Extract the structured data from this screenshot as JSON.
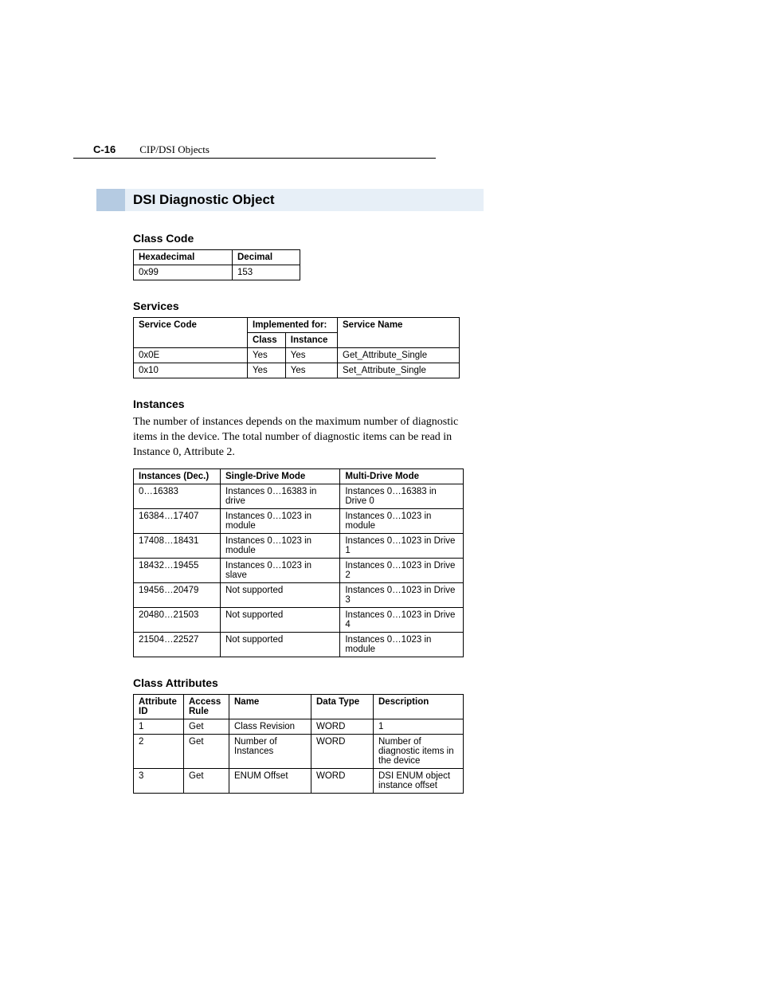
{
  "header": {
    "page_number": "C-16",
    "chapter": "CIP/DSI Objects"
  },
  "title": "DSI Diagnostic Object",
  "class_code": {
    "heading": "Class Code",
    "cols": {
      "hex": "Hexadecimal",
      "dec": "Decimal"
    },
    "row": {
      "hex": "0x99",
      "dec": "153"
    }
  },
  "services": {
    "heading": "Services",
    "cols": {
      "code": "Service Code",
      "impl": "Implemented for:",
      "class": "Class",
      "instance": "Instance",
      "name": "Service Name"
    },
    "rows": [
      {
        "code": "0x0E",
        "class": "Yes",
        "instance": "Yes",
        "name": "Get_Attribute_Single"
      },
      {
        "code": "0x10",
        "class": "Yes",
        "instance": "Yes",
        "name": "Set_Attribute_Single"
      }
    ]
  },
  "instances": {
    "heading": "Instances",
    "body": "The number of instances depends on the maximum number of diagnostic items in the device. The total number of diagnostic items can be read in Instance 0, Attribute 2.",
    "cols": {
      "dec": "Instances (Dec.)",
      "single": "Single-Drive Mode",
      "multi": "Multi-Drive Mode"
    },
    "rows": [
      {
        "dec": "0…16383",
        "single": "Instances 0…16383 in drive",
        "multi": "Instances 0…16383 in Drive 0"
      },
      {
        "dec": "16384…17407",
        "single": "Instances 0…1023 in module",
        "multi": "Instances 0…1023 in module"
      },
      {
        "dec": "17408…18431",
        "single": "Instances 0…1023 in module",
        "multi": "Instances 0…1023 in Drive 1"
      },
      {
        "dec": "18432…19455",
        "single": "Instances 0…1023 in slave",
        "multi": "Instances 0…1023 in Drive 2"
      },
      {
        "dec": "19456…20479",
        "single": "Not supported",
        "multi": "Instances 0…1023 in Drive 3"
      },
      {
        "dec": "20480…21503",
        "single": "Not supported",
        "multi": "Instances 0…1023 in Drive 4"
      },
      {
        "dec": "21504…22527",
        "single": "Not supported",
        "multi": "Instances 0…1023 in module"
      }
    ]
  },
  "class_attributes": {
    "heading": "Class Attributes",
    "cols": {
      "id": "Attribute ID",
      "rule": "Access Rule",
      "name": "Name",
      "type": "Data Type",
      "desc": "Description"
    },
    "rows": [
      {
        "id": "1",
        "rule": "Get",
        "name": "Class Revision",
        "type": "WORD",
        "desc": "1"
      },
      {
        "id": "2",
        "rule": "Get",
        "name": "Number of Instances",
        "type": "WORD",
        "desc": "Number of diagnostic items in the device"
      },
      {
        "id": "3",
        "rule": "Get",
        "name": "ENUM Offset",
        "type": "WORD",
        "desc": "DSI ENUM object instance offset"
      }
    ]
  }
}
